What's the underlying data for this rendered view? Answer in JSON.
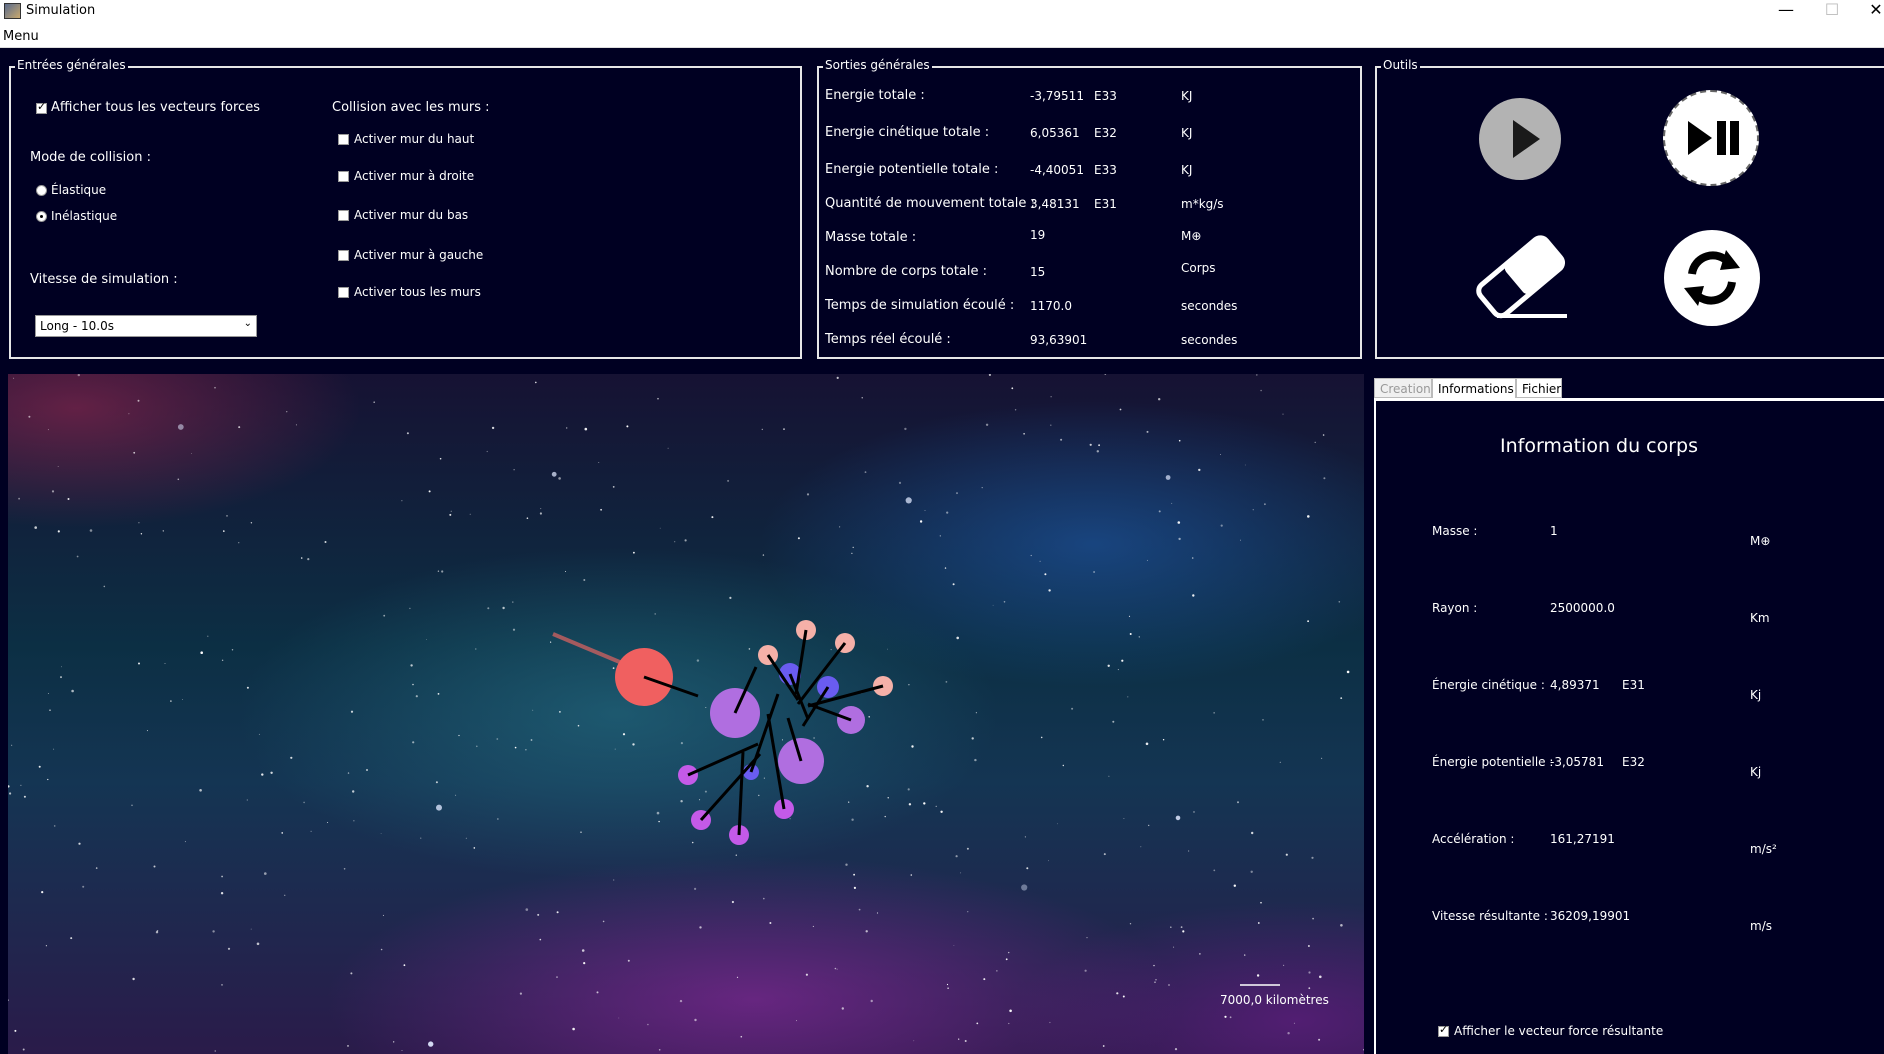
{
  "window": {
    "title": "Simulation",
    "minimize": "—",
    "maximize": "☐",
    "close": "✕"
  },
  "menu": {
    "label": "Menu"
  },
  "inputs": {
    "legend": "Entrées générales",
    "show_all_forces": "Afficher tous les vecteurs forces",
    "collision_mode_label": "Mode de collision :",
    "elastic": "Élastique",
    "inelastic": "Inélastique",
    "walls_label": "Collision avec les murs :",
    "wall_top": "Activer mur du haut",
    "wall_right": "Activer mur à droite",
    "wall_bottom": "Activer mur du bas",
    "wall_left": "Activer mur à gauche",
    "wall_all": "Activer tous les murs",
    "speed_label": "Vitesse de simulation :",
    "speed_value": "Long - 10.0s"
  },
  "outputs": {
    "legend": "Sorties générales",
    "rows": [
      {
        "label": "Energie totale :",
        "value": "-3,79511",
        "exp": "E33",
        "unit": "KJ"
      },
      {
        "label": "Energie cinétique totale :",
        "value": "6,05361",
        "exp": "E32",
        "unit": "KJ"
      },
      {
        "label": "Energie potentielle totale :",
        "value": "-4,40051",
        "exp": "E33",
        "unit": "KJ"
      },
      {
        "label": "Quantité de mouvement totale :",
        "value": "3,48131",
        "exp": "E31",
        "unit": "m*kg/s"
      },
      {
        "label": "Masse totale :",
        "value": "19",
        "exp": "",
        "unit": "M⊕"
      },
      {
        "label": "Nombre de corps totale :",
        "value": "15",
        "exp": "",
        "unit": "Corps"
      },
      {
        "label": "Temps de simulation écoulé :",
        "value": "1170.0",
        "exp": "",
        "unit": "secondes"
      },
      {
        "label": "Temps réel écoulé :",
        "value": "93,63901",
        "exp": "",
        "unit": "secondes"
      }
    ]
  },
  "tools": {
    "legend": "Outils",
    "play_icon": "play-icon",
    "step_icon": "play-pause-icon",
    "eraser_icon": "eraser-icon",
    "reset_icon": "refresh-icon"
  },
  "canvas": {
    "scale_label": "7000,0 kilomètres"
  },
  "tabs": {
    "creation": "Creation",
    "informations": "Informations",
    "file": "Fichier"
  },
  "body_info": {
    "title": "Information du corps",
    "mass_label": "Masse :",
    "mass_value": "1",
    "mass_unit": "M⊕",
    "radius_label": "Rayon :",
    "radius_value": "2500000.0",
    "radius_unit": "Km",
    "kinetic_label": "Énergie cinétique :",
    "kinetic_value": "4,89371",
    "kinetic_exp": "E31",
    "kinetic_unit": "Kj",
    "potential_label": "Énergie potentielle :",
    "potential_value": "-3,05781",
    "potential_exp": "E32",
    "potential_unit": "Kj",
    "accel_label": "Accélération :",
    "accel_value": "161,27191",
    "accel_unit": "m/s²",
    "speed_label": "Vitesse résultante :",
    "speed_value": "36209,19901",
    "speed_unit": "m/s",
    "show_force": "Afficher le vecteur force résultante"
  },
  "colors": {
    "background": "#000022",
    "border": "#e6e6e6",
    "body_red": "#f06060",
    "body_violet": "#b06ee0",
    "body_blue": "#6a5cf0",
    "body_pink": "#f5b0a8",
    "body_magenta": "#c45ae8"
  }
}
